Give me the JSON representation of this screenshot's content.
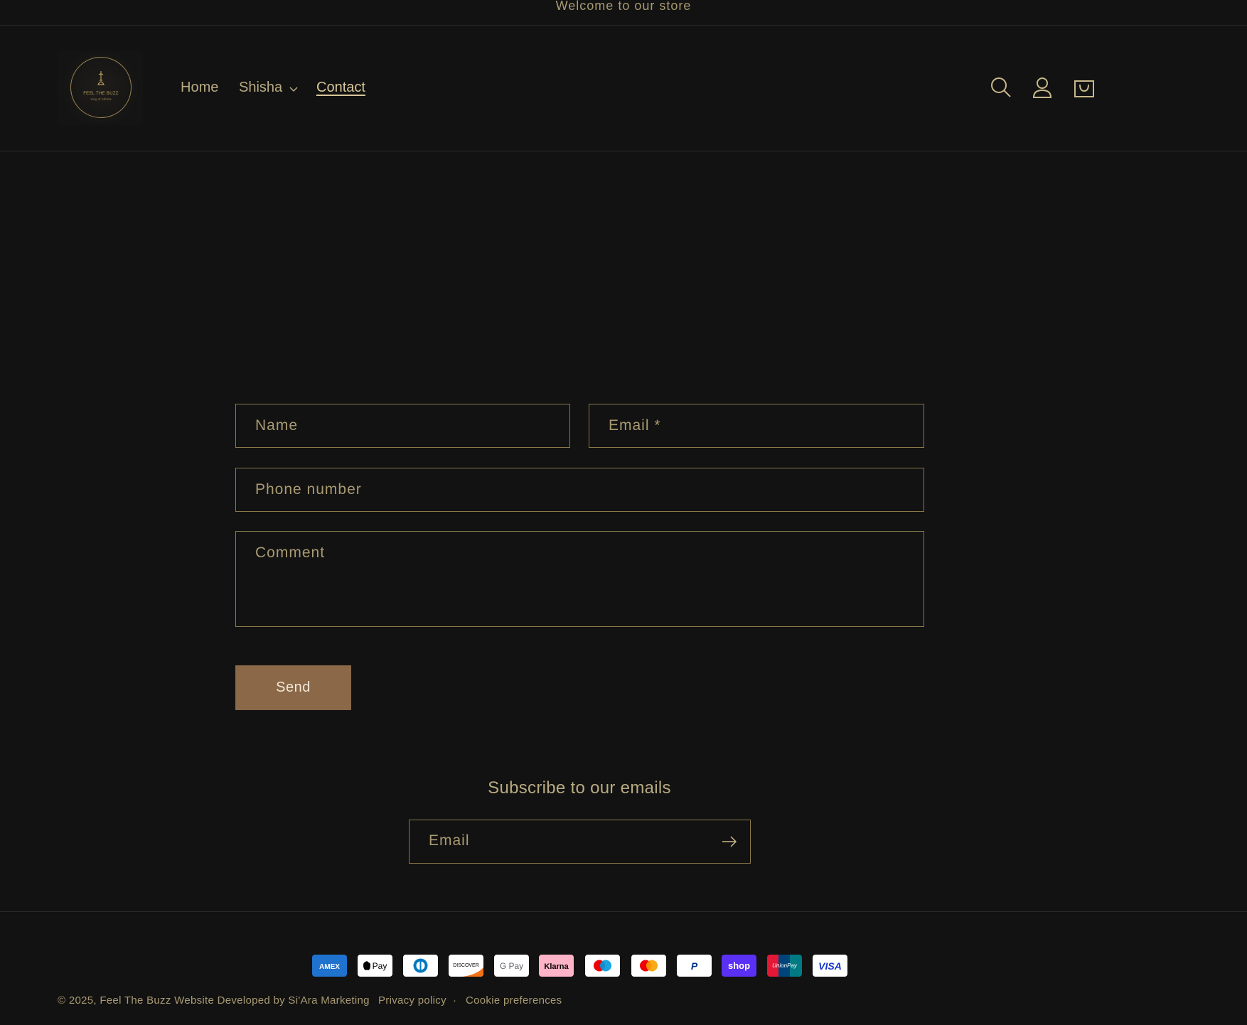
{
  "announcement": "Welcome to our store",
  "logo": {
    "text": "FEEL THE BUZZ",
    "subtext": "King of Shisha"
  },
  "nav": {
    "home": "Home",
    "shisha": "Shisha",
    "contact": "Contact"
  },
  "header_icons": [
    "search-icon",
    "account-icon",
    "cart-icon"
  ],
  "contact_form": {
    "name_placeholder": "Name",
    "email_placeholder": "Email *",
    "phone_placeholder": "Phone number",
    "comment_placeholder": "Comment",
    "send_label": "Send"
  },
  "newsletter": {
    "title": "Subscribe to our emails",
    "email_placeholder": "Email"
  },
  "payment_methods": [
    {
      "name": "American Express",
      "label": "AMEX"
    },
    {
      "name": "Apple Pay",
      "label": "Pay"
    },
    {
      "name": "Diners Club",
      "label": ""
    },
    {
      "name": "Discover",
      "label": "DISCOVER"
    },
    {
      "name": "Google Pay",
      "label": "G Pay"
    },
    {
      "name": "Klarna",
      "label": "Klarna"
    },
    {
      "name": "Maestro",
      "label": ""
    },
    {
      "name": "Mastercard",
      "label": ""
    },
    {
      "name": "PayPal",
      "label": "P"
    },
    {
      "name": "Shop Pay",
      "label": "shop"
    },
    {
      "name": "UnionPay",
      "label": "UnionPay"
    },
    {
      "name": "Visa",
      "label": "VISA"
    }
  ],
  "footer": {
    "copyright": "© 2025, Feel The Buzz Website Developed by Si'Ara Marketing",
    "separator": "·",
    "privacy": "Privacy policy",
    "cookie": "Cookie preferences"
  },
  "colors": {
    "background": "#121212",
    "accent_gold": "#c8b88a",
    "field_border": "#8a7a4a",
    "button": "#8a6848"
  }
}
